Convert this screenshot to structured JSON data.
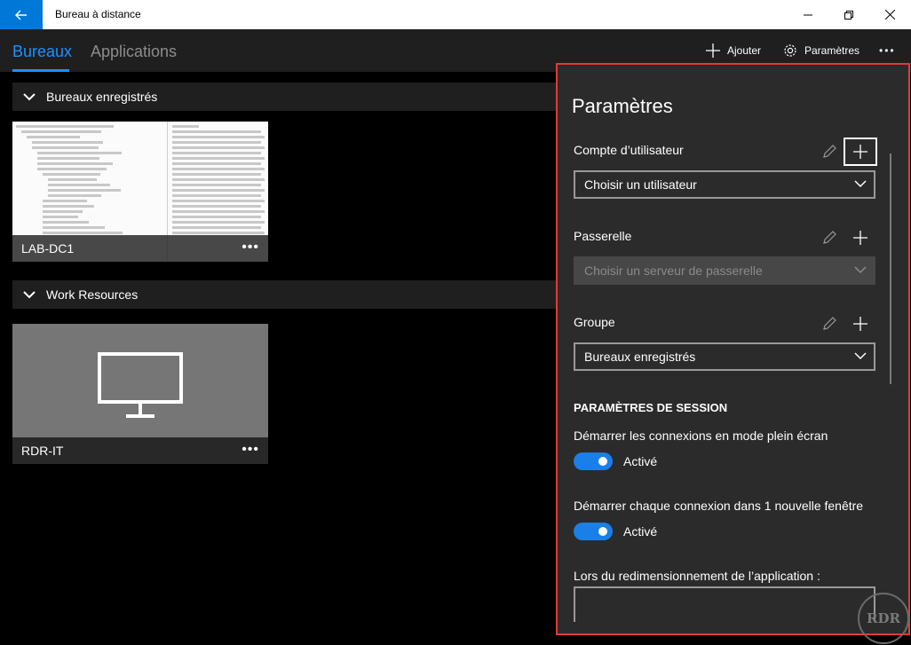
{
  "window": {
    "title": "Bureau à distance"
  },
  "nav": {
    "tabs": [
      {
        "label": "Bureaux",
        "active": true
      },
      {
        "label": "Applications",
        "active": false
      }
    ],
    "add_label": "Ajouter",
    "settings_label": "Paramètres",
    "more_label": "•••"
  },
  "groups": [
    {
      "label": "Bureaux enregistrés",
      "tiles": [
        {
          "label": "LAB-DC1",
          "more": "•••"
        }
      ]
    },
    {
      "label": "Work Resources",
      "tiles": [
        {
          "label": "RDR-IT",
          "more": "•••"
        }
      ]
    }
  ],
  "settings": {
    "title": "Paramètres",
    "user_account": {
      "label": "Compte d’utilisateur",
      "value": "Choisir un utilisateur"
    },
    "gateway": {
      "label": "Passerelle",
      "placeholder": "Choisir un serveur de passerelle"
    },
    "group": {
      "label": "Groupe",
      "value": "Bureaux enregistrés"
    },
    "session_heading": "PARAMÈTRES DE SESSION",
    "fullscreen": {
      "label": "Démarrer les connexions en mode plein écran",
      "state": "Activé"
    },
    "new_window": {
      "label": "Démarrer chaque connexion dans 1 nouvelle fenêtre",
      "state": "Activé"
    },
    "resize": {
      "label": "Lors du redimensionnement de l’application :"
    }
  },
  "colors": {
    "accent": "#0078d7",
    "highlight_border": "#e53935"
  },
  "watermark": "RDR"
}
